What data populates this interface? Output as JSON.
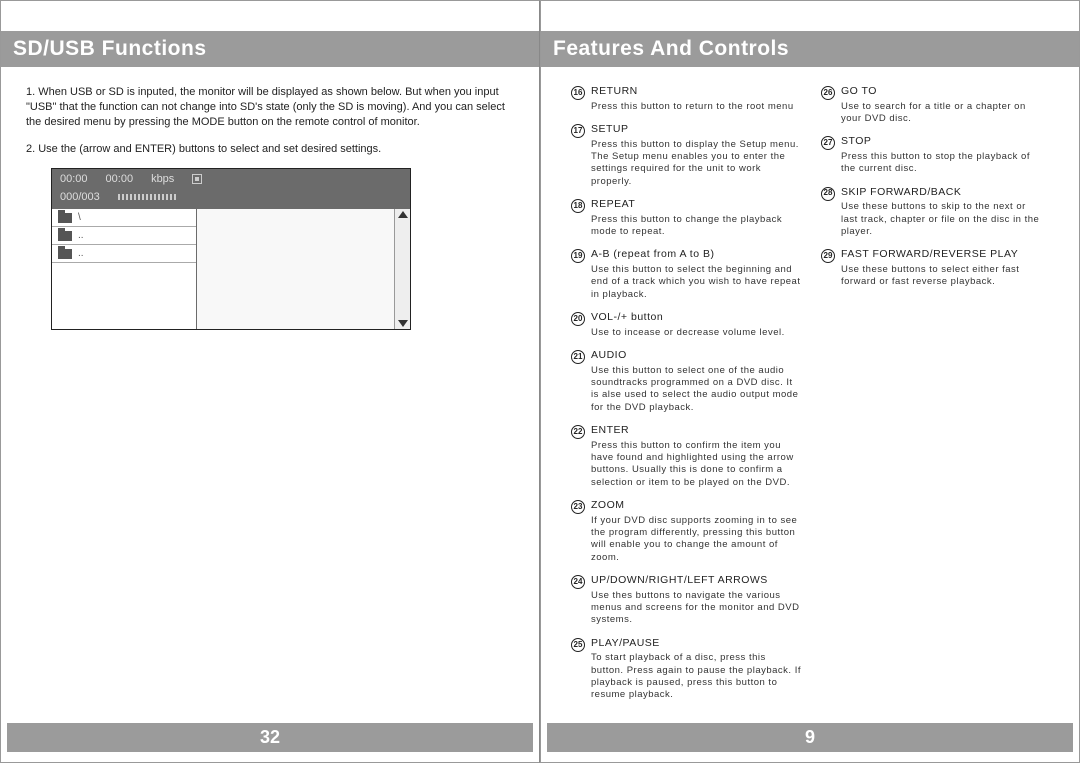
{
  "left_page": {
    "title": "SD/USB Functions",
    "para1": "1. When USB or SD is inputed, the monitor will be displayed as shown below. But when you input  \"USB\"  that the function can not change into SD's state (only the SD is moving). And you can select the desired menu by pressing the MODE button on the remote control of monitor.",
    "para2": "2. Use the (arrow and ENTER) buttons to select and set desired settings.",
    "monitor": {
      "time1": "00:00",
      "time2": "00:00",
      "kbps": "kbps",
      "counter": "000/003",
      "row1": "\\",
      "row2": "..",
      "row3": ".."
    },
    "page_number": "32"
  },
  "right_page": {
    "title": "Features And Controls",
    "col1": [
      {
        "n": "16",
        "title": "RETURN",
        "desc": "Press this button to return to the root menu"
      },
      {
        "n": "17",
        "title": "SETUP",
        "desc": "Press this button to display the Setup menu. The Setup menu enables you to enter the settings required for the unit to work properly."
      },
      {
        "n": "18",
        "title": "REPEAT",
        "desc": "Press this button to change the playback mode to repeat."
      },
      {
        "n": "19",
        "title": "A-B (repeat from A to B)",
        "desc": "Use this button to select the beginning and end of a track which you wish to have repeat in playback."
      },
      {
        "n": "20",
        "title": "VOL-/+ button",
        "desc": "Use to incease or decrease volume level."
      },
      {
        "n": "21",
        "title": "AUDIO",
        "desc": "Use this button to select one of the audio soundtracks programmed on a DVD disc. It is alse used to select the audio output mode for the DVD playback."
      },
      {
        "n": "22",
        "title": "ENTER",
        "desc": "Press this button to confirm the item you have found and highlighted using the arrow buttons. Usually this is done to confirm a selection or item to be played on the DVD."
      },
      {
        "n": "23",
        "title": "ZOOM",
        "desc": "If your DVD disc supports zooming in to see the program differently, pressing this button will enable you to change the amount of zoom."
      },
      {
        "n": "24",
        "title": "UP/DOWN/RIGHT/LEFT ARROWS",
        "desc": "Use thes buttons to navigate the various menus and screens for the monitor and DVD systems."
      },
      {
        "n": "25",
        "title": "PLAY/PAUSE",
        "desc": "To start playback of a disc, press this button. Press again to pause the playback. If playback is paused, press this button to resume playback."
      }
    ],
    "col2": [
      {
        "n": "26",
        "title": "GO TO",
        "desc": "Use to search for a title or a chapter on your DVD disc."
      },
      {
        "n": "27",
        "title": "STOP",
        "desc": "Press this button to stop the playback of the current disc."
      },
      {
        "n": "28",
        "title": "SKIP FORWARD/BACK",
        "desc": "Use these buttons to skip to the next or last track, chapter or file on the disc in the player."
      },
      {
        "n": "29",
        "title": "FAST FORWARD/REVERSE PLAY",
        "desc": "Use these buttons to select either fast forward or fast reverse playback."
      }
    ],
    "page_number": "9"
  }
}
